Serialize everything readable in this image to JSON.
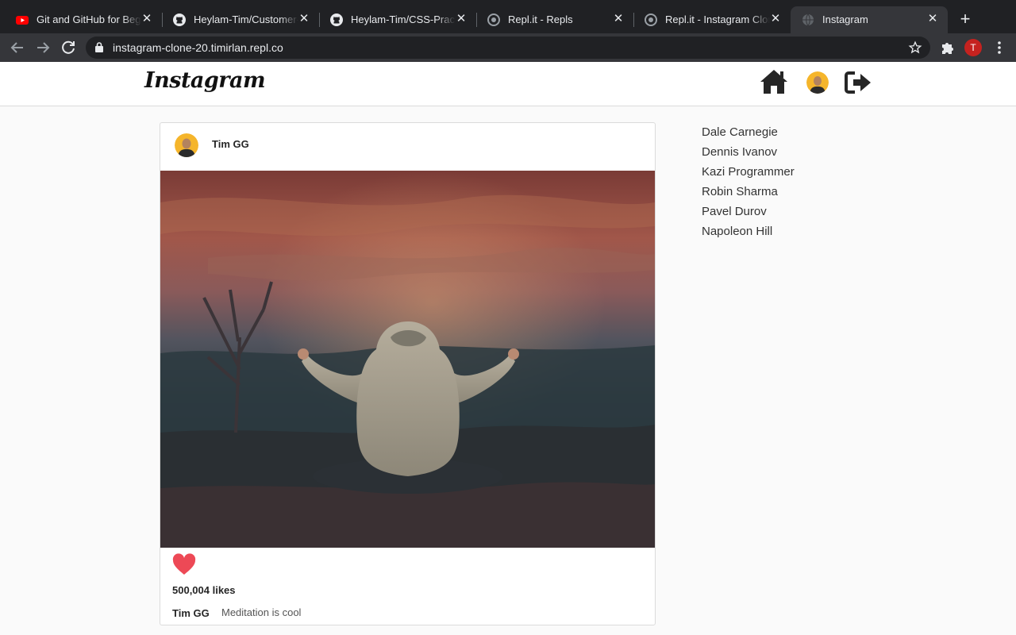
{
  "browser": {
    "tabs": [
      {
        "title": "Git and GitHub for Beginners",
        "icon": "youtube-icon",
        "active": false
      },
      {
        "title": "Heylam-Tim/Customer-Manager",
        "icon": "github-icon",
        "active": false
      },
      {
        "title": "Heylam-Tim/CSS-Practice",
        "icon": "github-icon",
        "active": false
      },
      {
        "title": "Repl.it - Repls",
        "icon": "replit-icon",
        "active": false
      },
      {
        "title": "Repl.it - Instagram Clone",
        "icon": "replit-icon",
        "active": false
      },
      {
        "title": "Instagram",
        "icon": "globe-icon",
        "active": true
      }
    ],
    "close_glyph": "✕",
    "new_tab_glyph": "+",
    "url": "instagram-clone-20.timirlan.repl.co",
    "profile_initial": "T",
    "colors": {
      "tabbar": "#202124",
      "toolbar": "#35363a",
      "profile": "#c5221f"
    }
  },
  "site": {
    "logo": "Instagram",
    "nav": {
      "home_icon": "home-icon",
      "profile_icon": "avatar",
      "logout_icon": "sign-out-icon"
    }
  },
  "post": {
    "username": "Tim GG",
    "likes_text": "500,004 likes",
    "caption_user": "Tim GG",
    "caption": "Meditation is cool",
    "liked": true,
    "like_color": "#ed4956",
    "image_description_icon": "post-photo"
  },
  "suggestions": [
    "Dale Carnegie",
    "Dennis Ivanov",
    "Kazi Programmer",
    "Robin Sharma",
    "Pavel Durov",
    "Napoleon Hill"
  ]
}
